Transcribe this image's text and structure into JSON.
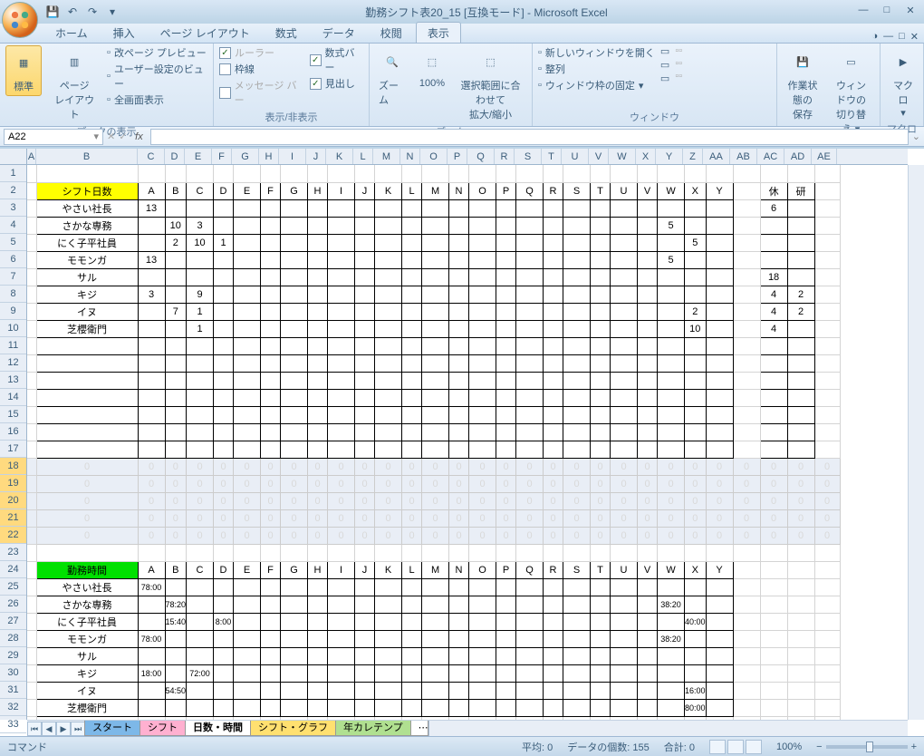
{
  "title": "勤務シフト表20_15 [互換モード] - Microsoft Excel",
  "tabs": [
    "ホーム",
    "挿入",
    "ページ レイアウト",
    "数式",
    "データ",
    "校閲",
    "表示"
  ],
  "activeTab": 6,
  "ribbon": {
    "g1": {
      "label": "ブックの表示",
      "btns": [
        "標準",
        "ページ\nレイアウト"
      ],
      "items": [
        "改ページ プレビュー",
        "ユーザー設定のビュー",
        "全画面表示"
      ]
    },
    "g2": {
      "label": "表示/非表示",
      "checks": [
        {
          "l": "ルーラー",
          "c": true,
          "d": true
        },
        {
          "l": "数式バー",
          "c": true
        },
        {
          "l": "枠線",
          "c": false
        },
        {
          "l": "見出し",
          "c": true
        },
        {
          "l": "メッセージ バー",
          "c": false,
          "d": true
        }
      ]
    },
    "g3": {
      "label": "ズーム",
      "btns": [
        "ズーム",
        "100%",
        "選択範囲に合わせて\n拡大/縮小"
      ]
    },
    "g4": {
      "label": "ウィンドウ",
      "items": [
        "新しいウィンドウを開く",
        "整列",
        "ウィンドウ枠の固定"
      ]
    },
    "g5": {
      "btns": [
        "作業状態の\n保存",
        "ウィンドウの\n切り替え ▾"
      ]
    },
    "g6": {
      "label": "マクロ",
      "btn": "マクロ\n▾"
    }
  },
  "namebox": "A22",
  "colHeaders": [
    "A",
    "B",
    "C",
    "D",
    "E",
    "F",
    "G",
    "H",
    "I",
    "J",
    "K",
    "L",
    "M",
    "N",
    "O",
    "P",
    "Q",
    "R",
    "S",
    "T",
    "U",
    "V",
    "W",
    "X",
    "Y",
    "Z",
    "AA",
    "AB",
    "AC",
    "AD",
    "AE"
  ],
  "rowStart": 1,
  "rowEnd": 33,
  "section1": {
    "title": "シフト日数",
    "cols": [
      "A",
      "B",
      "C",
      "D",
      "E",
      "F",
      "G",
      "H",
      "I",
      "J",
      "K",
      "L",
      "M",
      "N",
      "O",
      "P",
      "Q",
      "R",
      "S",
      "T",
      "U",
      "V",
      "W",
      "X",
      "Y",
      "",
      "休",
      "研"
    ],
    "rows": [
      {
        "name": "やさい社長",
        "v": {
          "A": "13"
        },
        "休": "6"
      },
      {
        "name": "さかな専務",
        "v": {
          "B": "10",
          "C": "3",
          "W": "5"
        }
      },
      {
        "name": "にく子平社員",
        "v": {
          "B": "2",
          "C": "10",
          "D": "1",
          "X": "5"
        }
      },
      {
        "name": "モモンガ",
        "v": {
          "A": "13",
          "W": "5"
        }
      },
      {
        "name": "サル",
        "v": {},
        "休": "18"
      },
      {
        "name": "キジ",
        "v": {
          "A": "3",
          "C": "9"
        },
        "休": "4",
        "研": "2"
      },
      {
        "name": "イヌ",
        "v": {
          "B": "7",
          "C": "1",
          "X": "2"
        },
        "休": "4",
        "研": "2"
      },
      {
        "name": "芝櫻衛門",
        "v": {
          "C": "1",
          "X": "10"
        },
        "休": "4"
      }
    ]
  },
  "section2": {
    "title": "勤務時間",
    "cols": [
      "A",
      "B",
      "C",
      "D",
      "E",
      "F",
      "G",
      "H",
      "I",
      "J",
      "K",
      "L",
      "M",
      "N",
      "O",
      "P",
      "Q",
      "R",
      "S",
      "T",
      "U",
      "V",
      "W",
      "X",
      "Y"
    ],
    "rows": [
      {
        "name": "やさい社長",
        "v": {
          "A": "78:00"
        }
      },
      {
        "name": "さかな専務",
        "v": {
          "B": "78:20",
          "W": "38:20"
        }
      },
      {
        "name": "にく子平社員",
        "v": {
          "B": "15:40",
          "D": "8:00",
          "X": "40:00"
        }
      },
      {
        "name": "モモンガ",
        "v": {
          "A": "78:00",
          "W": "38:20"
        }
      },
      {
        "name": "サル",
        "v": {}
      },
      {
        "name": "キジ",
        "v": {
          "A": "18:00",
          "C": "72:00"
        }
      },
      {
        "name": "イヌ",
        "v": {
          "B": "54:50",
          "X": "16:00"
        }
      },
      {
        "name": "芝櫻衛門",
        "v": {
          "X": "80:00"
        }
      }
    ]
  },
  "sheetTabs": [
    {
      "l": "スタート",
      "c": "#7db8e8"
    },
    {
      "l": "シフト",
      "c": "#ffb0d0"
    },
    {
      "l": "日数・時間",
      "c": "#ffffff",
      "active": true
    },
    {
      "l": "シフト・グラフ",
      "c": "#ffe070"
    },
    {
      "l": "年カレテンプ",
      "c": "#b0e090"
    }
  ],
  "status": {
    "mode": "コマンド",
    "avg": "平均: 0",
    "count": "データの個数: 155",
    "sum": "合計: 0",
    "zoom": "100%"
  }
}
